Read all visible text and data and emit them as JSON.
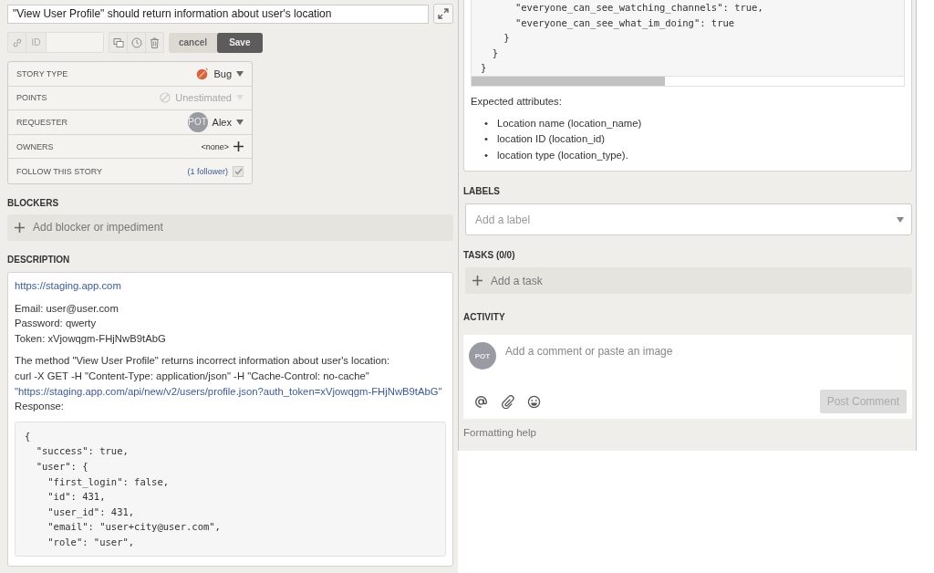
{
  "story": {
    "title": "\"View User Profile\" should return information about user's location",
    "id_label": "ID",
    "cancel": "cancel",
    "save": "Save"
  },
  "fields": [
    {
      "kind": "type",
      "label": "STORY TYPE",
      "value": "Bug"
    },
    {
      "kind": "points",
      "label": "POINTS",
      "value": "Unestimated",
      "disabled": true
    },
    {
      "kind": "person",
      "label": "REQUESTER",
      "avatar": "POT",
      "value": "Alex"
    },
    {
      "kind": "owners",
      "label": "OWNERS",
      "value": "<none>"
    },
    {
      "kind": "follow",
      "label": "FOLLOW THIS STORY",
      "value": "(1 follower)",
      "checked": true
    }
  ],
  "blockers": {
    "heading": "BLOCKERS",
    "add": "Add blocker or impediment"
  },
  "description": {
    "heading": "DESCRIPTION",
    "blocks": [
      {
        "kind": "lines",
        "lines": [
          {
            "text": "https://staging.app.com",
            "link": true
          }
        ]
      },
      {
        "kind": "lines",
        "lines": [
          {
            "text": "Email: user@user.com",
            "link": false
          },
          {
            "text": "Password: qwerty",
            "link": false
          },
          {
            "text": "Token: xVjowqgm-FHjNwB9tAbG",
            "link": false
          }
        ]
      },
      {
        "kind": "lines",
        "lines": [
          {
            "text": "The method \"View User Profile\" returns incorrect information about user's location:",
            "link": false
          },
          {
            "text": "curl -X GET -H \"Content-Type: application/json\" -H \"Cache-Control: no-cache\"",
            "link": false
          },
          {
            "text": "\"https://staging.app.com/api/new/v2/users/profile.json?auth_token=xVjowqgm-FHjNwB9tAbG\"",
            "link": true
          },
          {
            "text": "Response:",
            "link": false
          }
        ]
      },
      {
        "kind": "code",
        "lines": [
          "{",
          "  \"success\": true,",
          "  \"user\": {",
          "    \"first_login\": false,",
          "    \"id\": 431,",
          "    \"user_id\": 431,",
          "    \"email\": \"user+city@user.com\",",
          "    \"role\": \"user\","
        ]
      }
    ]
  },
  "side_description": {
    "code_lines": [
      "      \"everyone_can_see_watching_channels\": true,",
      "      \"everyone_can_see_what_im_doing\": true",
      "    }",
      "  }",
      "}"
    ],
    "text": "Expected attributes:",
    "bullets": [
      {
        "marker": "•",
        "text": "Location name (location_name)"
      },
      {
        "marker": "•",
        "text": "location ID (location_id)"
      },
      {
        "marker": "•",
        "text": "location type (location_type)."
      }
    ]
  },
  "labels": {
    "heading": "LABELS",
    "placeholder": "Add a label"
  },
  "tasks": {
    "heading": "TASKS (0/0)",
    "add": "Add a task"
  },
  "activity": {
    "heading": "ACTIVITY",
    "avatar": "POT",
    "placeholder": "Add a comment or paste an image",
    "post": "Post Comment",
    "post_disabled": true,
    "help": "Formatting help"
  }
}
